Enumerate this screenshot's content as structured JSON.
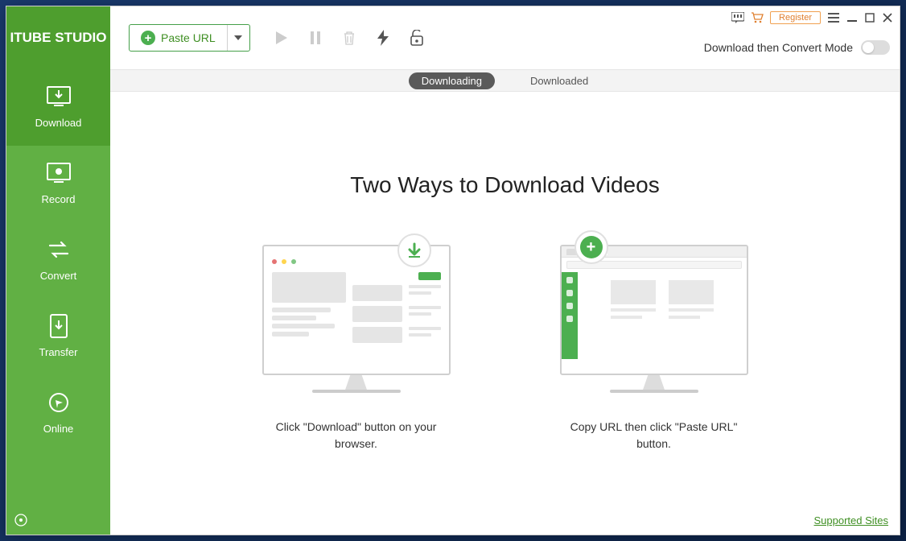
{
  "app": {
    "name": "ITUBE STUDIO"
  },
  "toolbar": {
    "paste_url": "Paste URL",
    "register": "Register",
    "mode_label": "Download then Convert Mode"
  },
  "sidebar": {
    "items": [
      {
        "label": "Download"
      },
      {
        "label": "Record"
      },
      {
        "label": "Convert"
      },
      {
        "label": "Transfer"
      },
      {
        "label": "Online"
      }
    ]
  },
  "tabs": {
    "downloading": "Downloading",
    "downloaded": "Downloaded"
  },
  "main": {
    "headline": "Two Ways to Download Videos",
    "method1": "Click \"Download\" button on your browser.",
    "method2": "Copy URL then click \"Paste URL\" button."
  },
  "footer": {
    "supported_sites": "Supported Sites"
  }
}
